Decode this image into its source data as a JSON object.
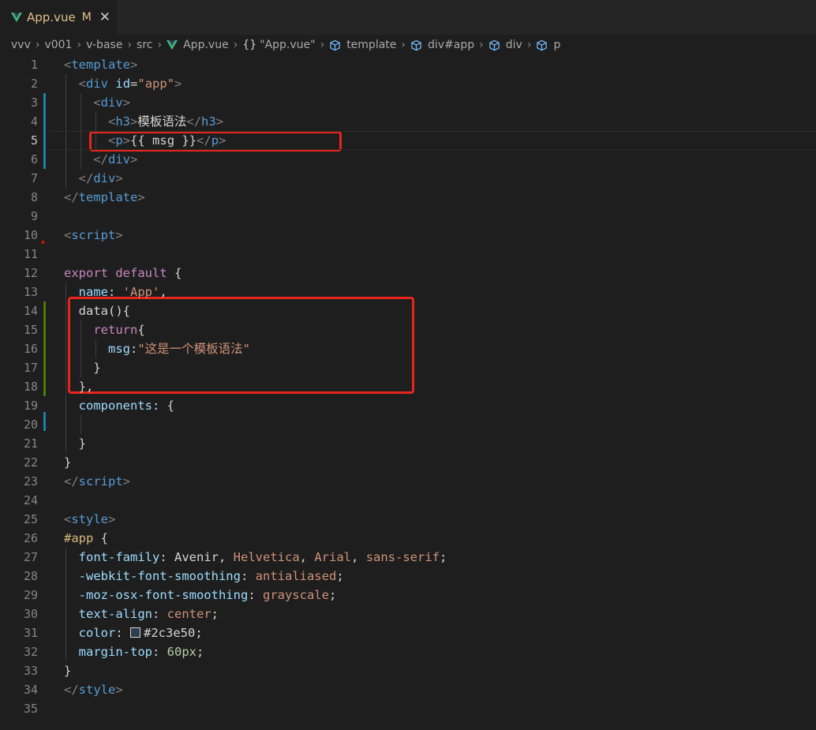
{
  "tab": {
    "filename": "App.vue",
    "status": "M",
    "close": "✕"
  },
  "breadcrumb": [
    {
      "label": "vvv",
      "icon": ""
    },
    {
      "label": "v001",
      "icon": ""
    },
    {
      "label": "v-base",
      "icon": ""
    },
    {
      "label": "src",
      "icon": ""
    },
    {
      "label": "App.vue",
      "icon": "vue-icon"
    },
    {
      "label": "\"App.vue\"",
      "icon": "braces-icon"
    },
    {
      "label": "template",
      "icon": "cube-icon"
    },
    {
      "label": "div#app",
      "icon": "cube-icon"
    },
    {
      "label": "div",
      "icon": "cube-icon"
    },
    {
      "label": "p",
      "icon": "cube-icon"
    }
  ],
  "breadcrumb_braces": "{}",
  "colors": {
    "accent_red": "#e8251c",
    "vue_green": "#41b883",
    "modified": "#e2c08d"
  },
  "active_line": 5,
  "lines": [
    [
      [
        "<",
        "br"
      ],
      [
        "template",
        "tag"
      ],
      [
        ">",
        "br"
      ]
    ],
    [
      [
        "  ",
        "txt"
      ],
      [
        "<",
        "br"
      ],
      [
        "div",
        "tag"
      ],
      [
        " ",
        "txt"
      ],
      [
        "id",
        "attr"
      ],
      [
        "=",
        "txt"
      ],
      [
        "\"app\"",
        "str"
      ],
      [
        ">",
        "br"
      ]
    ],
    [
      [
        "    ",
        "txt"
      ],
      [
        "<",
        "br"
      ],
      [
        "div",
        "tag"
      ],
      [
        ">",
        "br"
      ]
    ],
    [
      [
        "      ",
        "txt"
      ],
      [
        "<",
        "br"
      ],
      [
        "h3",
        "tag"
      ],
      [
        ">",
        "br"
      ],
      [
        "模板语法",
        "txt"
      ],
      [
        "</",
        "br"
      ],
      [
        "h3",
        "tag"
      ],
      [
        ">",
        "br"
      ]
    ],
    [
      [
        "      ",
        "txt"
      ],
      [
        "<",
        "br"
      ],
      [
        "p",
        "tag"
      ],
      [
        ">",
        "br"
      ],
      [
        "{{ msg }}",
        "txt"
      ],
      [
        "</",
        "br"
      ],
      [
        "p",
        "tag"
      ],
      [
        ">",
        "br"
      ]
    ],
    [
      [
        "    ",
        "txt"
      ],
      [
        "</",
        "br"
      ],
      [
        "div",
        "tag"
      ],
      [
        ">",
        "br"
      ]
    ],
    [
      [
        "  ",
        "txt"
      ],
      [
        "</",
        "br"
      ],
      [
        "div",
        "tag"
      ],
      [
        ">",
        "br"
      ]
    ],
    [
      [
        "</",
        "br"
      ],
      [
        "template",
        "tag"
      ],
      [
        ">",
        "br"
      ]
    ],
    [],
    [
      [
        "<",
        "br"
      ],
      [
        "script",
        "tag"
      ],
      [
        ">",
        "br"
      ]
    ],
    [],
    [
      [
        "export",
        "kw"
      ],
      [
        " ",
        "txt"
      ],
      [
        "default",
        "kw"
      ],
      [
        " {",
        "txt"
      ]
    ],
    [
      [
        "  ",
        "txt"
      ],
      [
        "name",
        "prop"
      ],
      [
        ": ",
        "txt"
      ],
      [
        "'App'",
        "str"
      ],
      [
        ",",
        "txt"
      ]
    ],
    [
      [
        "  ",
        "txt"
      ],
      [
        "data(){",
        "txt"
      ]
    ],
    [
      [
        "    ",
        "txt"
      ],
      [
        "return",
        "kw"
      ],
      [
        "{",
        "txt"
      ]
    ],
    [
      [
        "      ",
        "txt"
      ],
      [
        "msg",
        "prop"
      ],
      [
        ":",
        "txt"
      ],
      [
        "\"这是一个模板语法\"",
        "str"
      ]
    ],
    [
      [
        "    ",
        "txt"
      ],
      [
        "}",
        "txt"
      ]
    ],
    [
      [
        "  ",
        "txt"
      ],
      [
        "},",
        "txt"
      ]
    ],
    [
      [
        "  ",
        "txt"
      ],
      [
        "components",
        "prop"
      ],
      [
        ": {",
        "txt"
      ]
    ],
    [],
    [
      [
        "  ",
        "txt"
      ],
      [
        "}",
        "txt"
      ]
    ],
    [
      [
        "}",
        "txt"
      ]
    ],
    [
      [
        "</",
        "br"
      ],
      [
        "script",
        "tag"
      ],
      [
        ">",
        "br"
      ]
    ],
    [],
    [
      [
        "<",
        "br"
      ],
      [
        "style",
        "tag"
      ],
      [
        ">",
        "br"
      ]
    ],
    [
      [
        "#app",
        "sel"
      ],
      [
        " {",
        "txt"
      ]
    ],
    [
      [
        "  ",
        "txt"
      ],
      [
        "font-family",
        "prop"
      ],
      [
        ": ",
        "txt"
      ],
      [
        "Avenir",
        "txt"
      ],
      [
        ", ",
        "txt"
      ],
      [
        "Helvetica",
        "str"
      ],
      [
        ", ",
        "txt"
      ],
      [
        "Arial",
        "str"
      ],
      [
        ", ",
        "txt"
      ],
      [
        "sans-serif",
        "str"
      ],
      [
        ";",
        "txt"
      ]
    ],
    [
      [
        "  ",
        "txt"
      ],
      [
        "-webkit-font-smoothing",
        "prop"
      ],
      [
        ": ",
        "txt"
      ],
      [
        "antialiased",
        "str"
      ],
      [
        ";",
        "txt"
      ]
    ],
    [
      [
        "  ",
        "txt"
      ],
      [
        "-moz-osx-font-smoothing",
        "prop"
      ],
      [
        ": ",
        "txt"
      ],
      [
        "grayscale",
        "str"
      ],
      [
        ";",
        "txt"
      ]
    ],
    [
      [
        "  ",
        "txt"
      ],
      [
        "text-align",
        "prop"
      ],
      [
        ": ",
        "txt"
      ],
      [
        "center",
        "str"
      ],
      [
        ";",
        "txt"
      ]
    ],
    [
      [
        "  ",
        "txt"
      ],
      [
        "color",
        "prop"
      ],
      [
        ": ",
        "txt"
      ],
      [
        "#2c3e50",
        "swatch"
      ],
      [
        ";",
        "txt"
      ]
    ],
    [
      [
        "  ",
        "txt"
      ],
      [
        "margin-top",
        "prop"
      ],
      [
        ": ",
        "txt"
      ],
      [
        "60px",
        "num"
      ],
      [
        ";",
        "txt"
      ]
    ],
    [
      [
        "}",
        "txt"
      ]
    ],
    [
      [
        "</",
        "br"
      ],
      [
        "style",
        "tag"
      ],
      [
        ">",
        "br"
      ]
    ],
    []
  ]
}
